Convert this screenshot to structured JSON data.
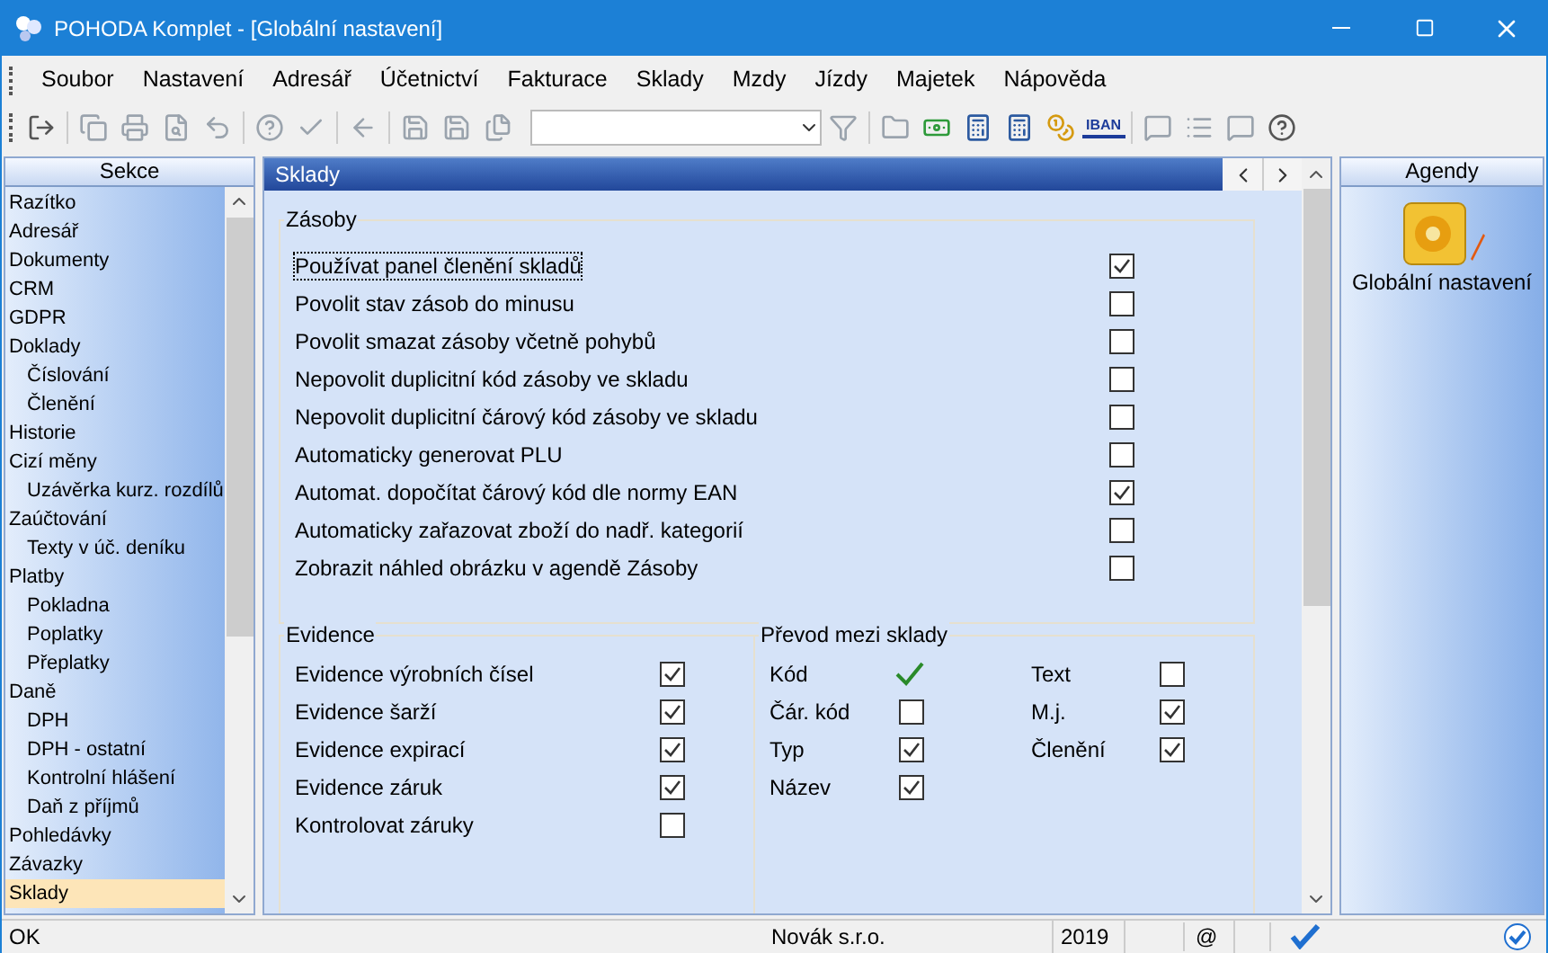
{
  "window": {
    "title": "POHODA Komplet - [Globální nastavení]"
  },
  "menu": [
    {
      "label": "Soubor"
    },
    {
      "label": "Nastavení"
    },
    {
      "label": "Adresář"
    },
    {
      "label": "Účetnictví"
    },
    {
      "label": "Fakturace"
    },
    {
      "label": "Sklady"
    },
    {
      "label": "Mzdy"
    },
    {
      "label": "Jízdy"
    },
    {
      "label": "Majetek"
    },
    {
      "label": "Nápověda"
    }
  ],
  "toolbar": {
    "iban_label": "IBAN"
  },
  "sections_panel": {
    "title": "Sekce",
    "items": [
      {
        "label": "Razítko",
        "selected": false
      },
      {
        "label": "Adresář",
        "selected": false
      },
      {
        "label": "Dokumenty",
        "selected": false
      },
      {
        "label": "CRM",
        "selected": false
      },
      {
        "label": "GDPR",
        "selected": false
      },
      {
        "label": "Doklady",
        "selected": false,
        "children": [
          {
            "label": "Číslování",
            "selected": false
          },
          {
            "label": "Členění",
            "selected": false
          }
        ]
      },
      {
        "label": "Historie",
        "selected": false
      },
      {
        "label": "Cizí měny",
        "selected": false,
        "children": [
          {
            "label": "Uzávěrka kurz. rozdílů",
            "selected": false
          }
        ]
      },
      {
        "label": "Zaúčtování",
        "selected": false,
        "children": [
          {
            "label": "Texty v úč. deníku",
            "selected": false
          }
        ]
      },
      {
        "label": "Platby",
        "selected": false,
        "children": [
          {
            "label": "Pokladna",
            "selected": false
          },
          {
            "label": "Poplatky",
            "selected": false
          },
          {
            "label": "Přeplatky",
            "selected": false
          }
        ]
      },
      {
        "label": "Daně",
        "selected": false,
        "children": [
          {
            "label": "DPH",
            "selected": false
          },
          {
            "label": "DPH - ostatní",
            "selected": false
          },
          {
            "label": "Kontrolní hlášení",
            "selected": false
          },
          {
            "label": "Daň z příjmů",
            "selected": false
          }
        ]
      },
      {
        "label": "Pohledávky",
        "selected": false
      },
      {
        "label": "Závazky",
        "selected": false
      },
      {
        "label": "Sklady",
        "selected": true
      }
    ]
  },
  "content": {
    "title": "Sklady",
    "stock_group": {
      "title": "Zásoby",
      "options": [
        {
          "label": "Používat panel členění skladů",
          "checked": true,
          "focused": true
        },
        {
          "label": "Povolit stav zásob do minusu",
          "checked": false,
          "focused": false
        },
        {
          "label": "Povolit smazat zásoby včetně pohybů",
          "checked": false,
          "focused": false
        },
        {
          "label": "Nepovolit duplicitní kód zásoby ve skladu",
          "checked": false,
          "focused": false
        },
        {
          "label": "Nepovolit duplicitní čárový kód zásoby ve skladu",
          "checked": false,
          "focused": false
        },
        {
          "label": "Automaticky generovat PLU",
          "checked": false,
          "focused": false
        },
        {
          "label": "Automat. dopočítat čárový kód dle normy EAN",
          "checked": true,
          "focused": false
        },
        {
          "label": "Automaticky zařazovat zboží do nadř. kategorií",
          "checked": false,
          "focused": false
        },
        {
          "label": "Zobrazit náhled obrázku v agendě Zásoby",
          "checked": false,
          "focused": false
        }
      ]
    },
    "evidence_group": {
      "title": "Evidence",
      "options": [
        {
          "label": "Evidence výrobních čísel",
          "checked": true
        },
        {
          "label": "Evidence šarží",
          "checked": true
        },
        {
          "label": "Evidence expirací",
          "checked": true
        },
        {
          "label": "Evidence záruk",
          "checked": true
        },
        {
          "label": "Kontrolovat záruky",
          "checked": false
        }
      ]
    },
    "transfer_group": {
      "title": "Převod mezi sklady",
      "columns": [
        [
          {
            "label": "Kód",
            "kind": "locked",
            "checked": true
          },
          {
            "label": "Čár. kód",
            "kind": "checkbox",
            "checked": false
          },
          {
            "label": "Typ",
            "kind": "checkbox",
            "checked": true
          },
          {
            "label": "Název",
            "kind": "checkbox",
            "checked": true
          }
        ],
        [
          {
            "label": "Text",
            "kind": "checkbox",
            "checked": false
          },
          {
            "label": "M.j.",
            "kind": "checkbox",
            "checked": true
          },
          {
            "label": "Členění",
            "kind": "checkbox",
            "checked": true
          }
        ]
      ]
    }
  },
  "agendas_panel": {
    "title": "Agendy",
    "items": [
      {
        "label": "Globální nastavení"
      }
    ]
  },
  "status_bar": {
    "message": "OK",
    "company": "Novák s.r.o.",
    "year": "2019",
    "email": "@"
  }
}
